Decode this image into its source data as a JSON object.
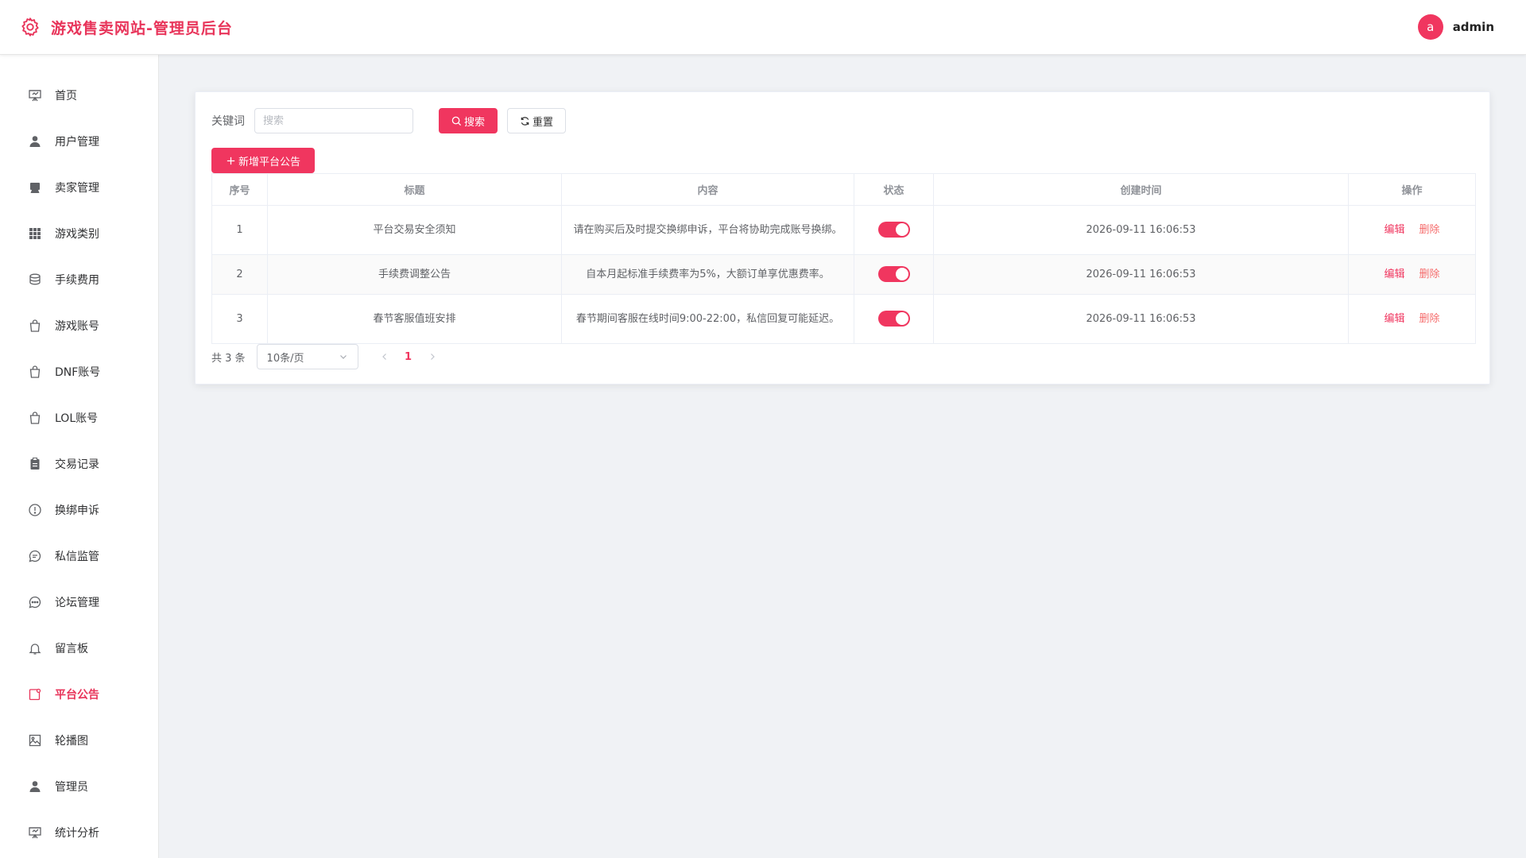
{
  "header": {
    "title": "游戏售卖网站-管理员后台",
    "avatar_letter": "a",
    "username": "admin",
    "brand_color": "#e8345a"
  },
  "sidebar": {
    "items": [
      {
        "label": "首页",
        "icon": "home-easel-icon"
      },
      {
        "label": "用户管理",
        "icon": "user-icon"
      },
      {
        "label": "卖家管理",
        "icon": "seller-icon"
      },
      {
        "label": "游戏类别",
        "icon": "grid-icon"
      },
      {
        "label": "手续费用",
        "icon": "coins-icon"
      },
      {
        "label": "游戏账号",
        "icon": "shopping-bag-icon"
      },
      {
        "label": "DNF账号",
        "icon": "shopping-bag-icon"
      },
      {
        "label": "LOL账号",
        "icon": "shopping-bag-icon"
      },
      {
        "label": "交易记录",
        "icon": "clipboard-icon"
      },
      {
        "label": "换绑申诉",
        "icon": "warning-circle-icon"
      },
      {
        "label": "私信监管",
        "icon": "chat-icon"
      },
      {
        "label": "论坛管理",
        "icon": "chat-dots-icon"
      },
      {
        "label": "留言板",
        "icon": "bell-icon"
      },
      {
        "label": "平台公告",
        "icon": "notice-icon",
        "active": true
      },
      {
        "label": "轮播图",
        "icon": "picture-icon"
      },
      {
        "label": "管理员",
        "icon": "admin-user-icon"
      },
      {
        "label": "统计分析",
        "icon": "chart-easel-icon"
      }
    ],
    "active_color": "#e8345a"
  },
  "search": {
    "label": "关键词",
    "placeholder": "搜索",
    "value": "",
    "search_label": "搜索",
    "reset_label": "重置"
  },
  "toolbar": {
    "add_label": "新增平台公告"
  },
  "table": {
    "columns": [
      "序号",
      "标题",
      "内容",
      "状态",
      "创建时间",
      "操作"
    ],
    "rows": [
      {
        "index": "1",
        "title": "平台交易安全须知",
        "content": "请在购买后及时提交换绑申诉，平台将协助完成账号换绑。",
        "status": true,
        "created": "2026-09-11 16:06:53"
      },
      {
        "index": "2",
        "title": "手续费调整公告",
        "content": "自本月起标准手续费率为5%，大额订单享优惠费率。",
        "status": true,
        "created": "2026-09-11 16:06:53"
      },
      {
        "index": "3",
        "title": "春节客服值班安排",
        "content": "春节期间客服在线时间9:00-22:00，私信回复可能延迟。",
        "status": true,
        "created": "2026-09-11 16:06:53"
      }
    ],
    "edit_label": "编辑",
    "delete_label": "删除"
  },
  "pagination": {
    "total_text": "共 3 条",
    "page_size": "10条/页",
    "current_page": "1"
  },
  "colors": {
    "primary": "#f0365f",
    "danger": "#f56c6c"
  }
}
